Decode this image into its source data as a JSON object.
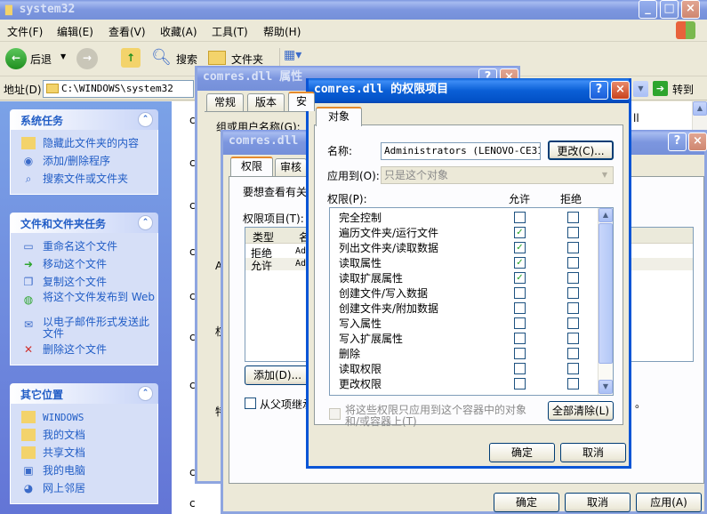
{
  "explorer": {
    "title": "system32",
    "menu": [
      "文件(F)",
      "编辑(E)",
      "查看(V)",
      "收藏(A)",
      "工具(T)",
      "帮助(H)"
    ],
    "toolbar": {
      "back": "后退",
      "search": "搜索",
      "folders": "文件夹"
    },
    "address": {
      "label": "地址(D)",
      "value": "C:\\WINDOWS\\system32",
      "go": "转到"
    },
    "system_tasks": {
      "title": "系统任务",
      "items": [
        "隐藏此文件夹的内容",
        "添加/删除程序",
        "搜索文件或文件夹"
      ]
    },
    "file_tasks": {
      "title": "文件和文件夹任务",
      "items": [
        "重命名这个文件",
        "移动这个文件",
        "复制这个文件",
        "将这个文件发布到 Web",
        "以电子邮件形式发送此文件",
        "删除这个文件"
      ]
    },
    "other_places": {
      "title": "其它位置",
      "items": [
        "WINDOWS",
        "我的文档",
        "共享文档",
        "我的电脑",
        "网上邻居"
      ]
    },
    "list_fragments": [
      "c",
      "c",
      "c",
      "c",
      "c",
      "c",
      "c",
      "c",
      "c"
    ]
  },
  "properties": {
    "title": "comres.dll 属性",
    "tabs": [
      "常规",
      "版本",
      "安"
    ],
    "group_label": "组或用户名称(G):",
    "right_snippet": "ll",
    "left_fragments": [
      "A",
      "权",
      "特"
    ]
  },
  "advanced": {
    "title": "comres.dll",
    "tabs": [
      "权限",
      "审核"
    ],
    "hint": "要想查看有关",
    "entries_label": "权限项目(T):",
    "columns": [
      "类型",
      "名"
    ],
    "rows": [
      {
        "type": "拒绝",
        "name": "Adm"
      },
      {
        "type": "允许",
        "name": "Adm"
      }
    ],
    "add_button": "添加(D)...",
    "inherit_label": "从父项继承",
    "right_dot": "。",
    "ok": "确定",
    "cancel": "取消",
    "apply": "应用(A)"
  },
  "entry_dialog": {
    "title": "comres.dll 的权限项目",
    "tab": "对象",
    "name_label": "名称:",
    "name_value": "Administrators (LENOVO-CE3164",
    "change_button": "更改(C)...",
    "apply_to_label": "应用到(O):",
    "apply_to_value": "只是这个对象",
    "perm_label": "权限(P):",
    "allow_header": "允许",
    "deny_header": "拒绝",
    "permissions": [
      {
        "name": "完全控制",
        "allow": false,
        "deny": false
      },
      {
        "name": "遍历文件夹/运行文件",
        "allow": true,
        "deny": false
      },
      {
        "name": "列出文件夹/读取数据",
        "allow": true,
        "deny": false
      },
      {
        "name": "读取属性",
        "allow": true,
        "deny": false
      },
      {
        "name": "读取扩展属性",
        "allow": true,
        "deny": false
      },
      {
        "name": "创建文件/写入数据",
        "allow": false,
        "deny": false
      },
      {
        "name": "创建文件夹/附加数据",
        "allow": false,
        "deny": false
      },
      {
        "name": "写入属性",
        "allow": false,
        "deny": false
      },
      {
        "name": "写入扩展属性",
        "allow": false,
        "deny": false
      },
      {
        "name": "删除",
        "allow": false,
        "deny": false
      },
      {
        "name": "读取权限",
        "allow": false,
        "deny": false
      },
      {
        "name": "更改权限",
        "allow": false,
        "deny": false
      }
    ],
    "inherit_check_label": "将这些权限只应用到这个容器中的对象和/或容器上(T)",
    "clear_all": "全部清除(L)",
    "ok": "确定",
    "cancel": "取消"
  },
  "colors": {
    "xp_blue": "#0a5fd6",
    "task_link": "#215dc6",
    "check_green": "#21a121"
  }
}
